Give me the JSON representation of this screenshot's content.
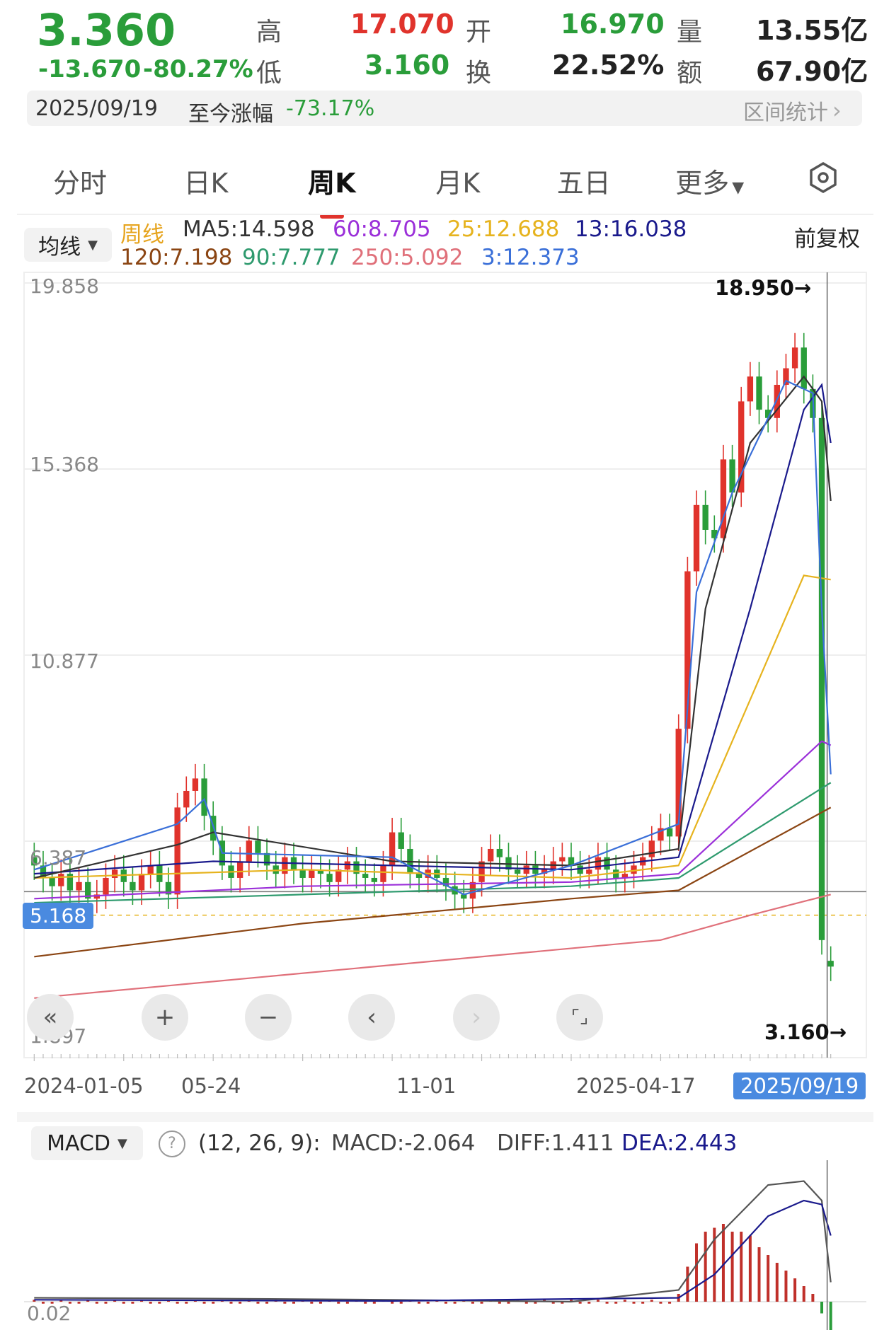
{
  "quote": {
    "price": "3.360",
    "change": "-13.670",
    "change_pct": "-80.27%",
    "high_label": "高",
    "high": "17.070",
    "low_label": "低",
    "low": "3.160",
    "open_label": "开",
    "open": "16.970",
    "turnover_label": "换",
    "turnover": "22.52%",
    "volume_label": "量",
    "volume": "13.55亿",
    "amount_label": "额",
    "amount": "67.90亿"
  },
  "summary": {
    "date": "2025/09/19",
    "since_label": "至今涨幅",
    "since_value": "-73.17%",
    "interval_link": "区间统计"
  },
  "tabs": [
    "分时",
    "日K",
    "周K",
    "月K",
    "五日",
    "更多"
  ],
  "active_tab": "周K",
  "ma_legend": {
    "selector": "均线",
    "period": "周线",
    "adjust": "前复权",
    "items": [
      {
        "text": "MA5:14.598",
        "color": "#333333"
      },
      {
        "text": "60:8.705",
        "color": "#9b30d9"
      },
      {
        "text": "25:12.688",
        "color": "#e6b31e"
      },
      {
        "text": "13:16.038",
        "color": "#1a1a8c"
      },
      {
        "text": "120:7.198",
        "color": "#8b4513"
      },
      {
        "text": "90:7.777",
        "color": "#2e9a6e"
      },
      {
        "text": "250:5.092",
        "color": "#e0707a"
      },
      {
        "text": "3:12.373",
        "color": "#3a6fd8"
      }
    ]
  },
  "chart_data": {
    "type": "candlestick",
    "y_ticks": [
      "19.858",
      "15.368",
      "10.877",
      "6.387",
      "1.897"
    ],
    "ylim": [
      1.897,
      19.858
    ],
    "current_price_tag": "5.168",
    "max_label": "18.950→",
    "min_label": "3.160→",
    "x_ticks": [
      "2024-01-05",
      "05-24",
      "11-01",
      "2025-04-17"
    ],
    "x_current": "2025/09/19",
    "weeks": 90,
    "candles": [
      {
        "i": 0,
        "o": 6.0,
        "c": 5.8
      },
      {
        "i": 1,
        "o": 5.8,
        "c": 5.5
      },
      {
        "i": 2,
        "o": 5.5,
        "c": 5.3
      },
      {
        "i": 3,
        "o": 5.3,
        "c": 5.6
      },
      {
        "i": 4,
        "o": 5.6,
        "c": 5.2
      },
      {
        "i": 5,
        "o": 5.2,
        "c": 5.4
      },
      {
        "i": 6,
        "o": 5.4,
        "c": 5.0
      },
      {
        "i": 7,
        "o": 5.0,
        "c": 5.1
      },
      {
        "i": 8,
        "o": 5.1,
        "c": 5.5
      },
      {
        "i": 9,
        "o": 5.5,
        "c": 5.7
      },
      {
        "i": 10,
        "o": 5.7,
        "c": 5.4
      },
      {
        "i": 11,
        "o": 5.4,
        "c": 5.2
      },
      {
        "i": 12,
        "o": 5.2,
        "c": 5.6
      },
      {
        "i": 13,
        "o": 5.6,
        "c": 5.8
      },
      {
        "i": 14,
        "o": 5.8,
        "c": 5.4
      },
      {
        "i": 15,
        "o": 5.4,
        "c": 5.1
      },
      {
        "i": 16,
        "o": 5.1,
        "c": 7.2
      },
      {
        "i": 17,
        "o": 7.2,
        "c": 7.6
      },
      {
        "i": 18,
        "o": 7.6,
        "c": 7.9
      },
      {
        "i": 19,
        "o": 7.9,
        "c": 7.0
      },
      {
        "i": 20,
        "o": 7.0,
        "c": 6.4
      },
      {
        "i": 21,
        "o": 6.4,
        "c": 5.8
      },
      {
        "i": 22,
        "o": 5.8,
        "c": 5.5
      },
      {
        "i": 23,
        "o": 5.5,
        "c": 5.9
      },
      {
        "i": 24,
        "o": 5.9,
        "c": 6.4
      },
      {
        "i": 25,
        "o": 6.4,
        "c": 6.1
      },
      {
        "i": 26,
        "o": 6.1,
        "c": 5.8
      },
      {
        "i": 27,
        "o": 5.8,
        "c": 5.6
      },
      {
        "i": 28,
        "o": 5.6,
        "c": 6.0
      },
      {
        "i": 29,
        "o": 6.0,
        "c": 5.7
      },
      {
        "i": 30,
        "o": 5.7,
        "c": 5.5
      },
      {
        "i": 31,
        "o": 5.5,
        "c": 5.7
      },
      {
        "i": 32,
        "o": 5.7,
        "c": 5.6
      },
      {
        "i": 33,
        "o": 5.6,
        "c": 5.4
      },
      {
        "i": 34,
        "o": 5.4,
        "c": 5.7
      },
      {
        "i": 35,
        "o": 5.7,
        "c": 5.9
      },
      {
        "i": 36,
        "o": 5.9,
        "c": 5.6
      },
      {
        "i": 37,
        "o": 5.6,
        "c": 5.5
      },
      {
        "i": 38,
        "o": 5.5,
        "c": 5.4
      },
      {
        "i": 39,
        "o": 5.4,
        "c": 5.8
      },
      {
        "i": 40,
        "o": 5.8,
        "c": 6.6
      },
      {
        "i": 41,
        "o": 6.6,
        "c": 6.2
      },
      {
        "i": 42,
        "o": 6.2,
        "c": 5.6
      },
      {
        "i": 43,
        "o": 5.6,
        "c": 5.5
      },
      {
        "i": 44,
        "o": 5.5,
        "c": 5.7
      },
      {
        "i": 45,
        "o": 5.7,
        "c": 5.5
      },
      {
        "i": 46,
        "o": 5.5,
        "c": 5.3
      },
      {
        "i": 47,
        "o": 5.3,
        "c": 5.1
      },
      {
        "i": 48,
        "o": 5.1,
        "c": 5.0
      },
      {
        "i": 49,
        "o": 5.0,
        "c": 5.4
      },
      {
        "i": 50,
        "o": 5.4,
        "c": 5.9
      },
      {
        "i": 51,
        "o": 5.9,
        "c": 6.2
      },
      {
        "i": 52,
        "o": 6.2,
        "c": 6.0
      },
      {
        "i": 53,
        "o": 6.0,
        "c": 5.7
      },
      {
        "i": 54,
        "o": 5.7,
        "c": 5.6
      },
      {
        "i": 55,
        "o": 5.6,
        "c": 5.8
      },
      {
        "i": 56,
        "o": 5.8,
        "c": 5.6
      },
      {
        "i": 57,
        "o": 5.6,
        "c": 5.7
      },
      {
        "i": 58,
        "o": 5.7,
        "c": 5.9
      },
      {
        "i": 59,
        "o": 5.9,
        "c": 6.0
      },
      {
        "i": 60,
        "o": 6.0,
        "c": 5.8
      },
      {
        "i": 61,
        "o": 5.8,
        "c": 5.6
      },
      {
        "i": 62,
        "o": 5.6,
        "c": 5.7
      },
      {
        "i": 63,
        "o": 5.7,
        "c": 6.0
      },
      {
        "i": 64,
        "o": 6.0,
        "c": 5.7
      },
      {
        "i": 65,
        "o": 5.7,
        "c": 5.5
      },
      {
        "i": 66,
        "o": 5.5,
        "c": 5.6
      },
      {
        "i": 67,
        "o": 5.6,
        "c": 5.8
      },
      {
        "i": 68,
        "o": 5.8,
        "c": 6.0
      },
      {
        "i": 69,
        "o": 6.0,
        "c": 6.4
      },
      {
        "i": 70,
        "o": 6.4,
        "c": 6.7
      },
      {
        "i": 71,
        "o": 6.7,
        "c": 6.5
      },
      {
        "i": 72,
        "o": 6.5,
        "c": 9.1
      },
      {
        "i": 73,
        "o": 9.1,
        "c": 12.9
      },
      {
        "i": 74,
        "o": 12.9,
        "c": 14.5
      },
      {
        "i": 75,
        "o": 14.5,
        "c": 13.9
      },
      {
        "i": 76,
        "o": 13.9,
        "c": 13.7
      },
      {
        "i": 77,
        "o": 13.7,
        "c": 15.6
      },
      {
        "i": 78,
        "o": 15.6,
        "c": 14.8
      },
      {
        "i": 79,
        "o": 14.8,
        "c": 17.0
      },
      {
        "i": 80,
        "o": 17.0,
        "c": 17.6
      },
      {
        "i": 81,
        "o": 17.6,
        "c": 16.8
      },
      {
        "i": 82,
        "o": 16.8,
        "c": 16.6
      },
      {
        "i": 83,
        "o": 16.6,
        "c": 17.4
      },
      {
        "i": 84,
        "o": 17.4,
        "c": 17.8
      },
      {
        "i": 85,
        "o": 17.8,
        "c": 18.3
      },
      {
        "i": 86,
        "o": 18.3,
        "c": 17.3
      },
      {
        "i": 87,
        "o": 17.3,
        "c": 16.6
      },
      {
        "i": 88,
        "o": 16.6,
        "c": 4.0
      },
      {
        "i": 89,
        "o": 3.5,
        "c": 3.36
      }
    ],
    "ma_lines": [
      {
        "color": "#e0707a",
        "pts": [
          [
            0,
            2.6
          ],
          [
            40,
            3.4
          ],
          [
            70,
            4.0
          ],
          [
            80,
            4.6
          ],
          [
            89,
            5.1
          ]
        ]
      },
      {
        "color": "#8b4513",
        "pts": [
          [
            0,
            3.6
          ],
          [
            30,
            4.4
          ],
          [
            60,
            5.0
          ],
          [
            72,
            5.2
          ],
          [
            89,
            7.2
          ]
        ]
      },
      {
        "color": "#2e9a6e",
        "pts": [
          [
            0,
            4.9
          ],
          [
            30,
            5.1
          ],
          [
            60,
            5.3
          ],
          [
            72,
            5.5
          ],
          [
            89,
            7.8
          ]
        ]
      },
      {
        "color": "#9b30d9",
        "pts": [
          [
            0,
            5.0
          ],
          [
            30,
            5.3
          ],
          [
            60,
            5.4
          ],
          [
            72,
            5.6
          ],
          [
            88,
            8.8
          ],
          [
            89,
            8.7
          ]
        ]
      },
      {
        "color": "#e6b31e",
        "pts": [
          [
            0,
            5.5
          ],
          [
            30,
            5.7
          ],
          [
            60,
            5.5
          ],
          [
            72,
            5.8
          ],
          [
            86,
            12.8
          ],
          [
            89,
            12.7
          ]
        ]
      },
      {
        "color": "#1a1a8c",
        "pts": [
          [
            0,
            5.6
          ],
          [
            20,
            5.9
          ],
          [
            40,
            5.8
          ],
          [
            60,
            5.7
          ],
          [
            72,
            6.0
          ],
          [
            80,
            12.0
          ],
          [
            86,
            16.8
          ],
          [
            88,
            17.4
          ],
          [
            89,
            16.0
          ]
        ]
      },
      {
        "color": "#333333",
        "pts": [
          [
            0,
            5.5
          ],
          [
            16,
            6.3
          ],
          [
            20,
            6.6
          ],
          [
            40,
            5.9
          ],
          [
            60,
            5.8
          ],
          [
            72,
            6.2
          ],
          [
            75,
            12.0
          ],
          [
            80,
            16.0
          ],
          [
            86,
            17.6
          ],
          [
            88,
            17.0
          ],
          [
            89,
            14.6
          ]
        ]
      },
      {
        "color": "#3a6fd8",
        "pts": [
          [
            0,
            5.7
          ],
          [
            16,
            6.8
          ],
          [
            19,
            7.4
          ],
          [
            21,
            6.1
          ],
          [
            40,
            6.0
          ],
          [
            48,
            5.1
          ],
          [
            60,
            5.8
          ],
          [
            72,
            6.8
          ],
          [
            74,
            12.4
          ],
          [
            78,
            14.8
          ],
          [
            84,
            17.5
          ],
          [
            87,
            17.2
          ],
          [
            88,
            12.0
          ],
          [
            89,
            8.0
          ]
        ]
      }
    ],
    "signals": [
      "1",
      "2",
      "3",
      "4",
      "5",
      "6",
      "7",
      "8",
      "9",
      "1",
      "2",
      "3",
      "4",
      "5",
      "6",
      "7",
      "8",
      "9"
    ]
  },
  "x_axis": {
    "labels": [
      "2024-01-05",
      "05-24",
      "11-01",
      "2025-04-17"
    ],
    "current": "2025/09/19"
  },
  "macd": {
    "selector": "MACD",
    "params": "(12, 26, 9):",
    "macd": "MACD:-2.064",
    "diff": "DIFF:1.411",
    "dea": "DEA:2.443",
    "zero_label": "0.02",
    "hist": [
      0,
      0,
      0,
      0,
      0,
      0,
      0,
      0,
      0,
      0,
      0,
      0,
      0,
      0,
      0,
      0,
      0,
      0,
      0,
      0,
      0,
      0,
      0,
      0,
      0,
      0,
      0,
      0,
      0,
      0,
      0,
      0,
      0,
      0,
      0,
      0,
      0,
      0,
      0,
      0,
      0,
      0,
      0,
      0,
      0,
      0,
      0,
      0,
      0,
      0,
      0,
      0,
      0,
      0,
      0,
      0,
      0,
      0,
      0,
      0,
      0,
      0,
      0,
      0,
      0,
      0,
      0,
      0,
      0,
      0,
      0,
      0,
      0.2,
      0.9,
      1.5,
      1.8,
      1.9,
      2.0,
      1.8,
      1.8,
      1.7,
      1.4,
      1.2,
      1.0,
      0.8,
      0.6,
      0.4,
      0.2,
      -0.3,
      -1.0
    ]
  },
  "controls": [
    "«",
    "+",
    "−",
    "‹",
    "›",
    "⌜⌟"
  ]
}
